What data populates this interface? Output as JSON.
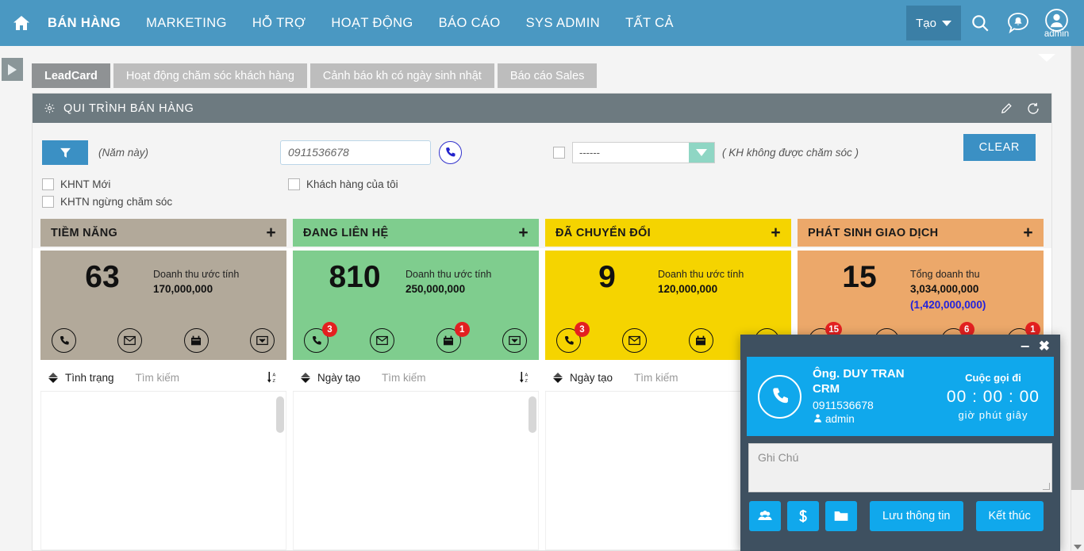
{
  "topnav": {
    "home_icon": "home-icon",
    "links": [
      "BÁN HÀNG",
      "MARKETING",
      "HỖ TRỢ",
      "HOẠT ĐỘNG",
      "BÁO CÁO",
      "SYS ADMIN",
      "TẤT CẢ"
    ],
    "create_button": "Tạo",
    "search_icon": "search-icon",
    "chat_icon": "chat-bell-icon",
    "avatar_label": "admin",
    "bg_color": "#4a98c2"
  },
  "tabs": [
    {
      "label": "LeadCard",
      "active": true
    },
    {
      "label": "Hoạt động chăm sóc khách hàng",
      "active": false
    },
    {
      "label": "Cảnh báo kh có ngày sinh nhật",
      "active": false
    },
    {
      "label": "Báo cáo Sales",
      "active": false
    }
  ],
  "panel": {
    "title": "QUI TRÌNH BÁN HÀNG",
    "gear_icon": "gear-icon",
    "edit_icon": "pencil-icon",
    "refresh_icon": "refresh-icon"
  },
  "filters": {
    "filter_icon": "funnel-icon",
    "year_label": "(Năm này)",
    "phone_value": "0911536678",
    "phone_placeholder": "0911536678",
    "call_icon": "phone-icon",
    "select_value": "------",
    "select_note": "( KH không được chăm sóc )",
    "clear_label": "CLEAR",
    "checkboxes": [
      {
        "label": "KHNT Mới",
        "checked": false
      },
      {
        "label": "KHTN ngừng chăm sóc",
        "checked": false
      },
      {
        "label": "Khách hàng của tôi",
        "checked": false
      }
    ]
  },
  "cards": [
    {
      "title": "TIỀM NĂNG",
      "head_color": "#b2a99a",
      "body_color": "#b2a99a",
      "count": "63",
      "revenue_label": "Doanh thu ước tính",
      "revenue_value": "170,000,000",
      "revenue_value2": "",
      "icons": [
        {
          "name": "phone-icon",
          "badge": ""
        },
        {
          "name": "email-icon",
          "badge": ""
        },
        {
          "name": "calendar-icon",
          "badge": ""
        },
        {
          "name": "inbox-icon",
          "badge": ""
        }
      ],
      "sort_field": "Tình trạng",
      "search_placeholder": "Tìm kiếm",
      "sort_icon": "sort-az-icon"
    },
    {
      "title": "ĐANG LIÊN HỆ",
      "head_color": "#7fcd8e",
      "body_color": "#7fcd8e",
      "count": "810",
      "revenue_label": "Doanh thu ước tính",
      "revenue_value": "250,000,000",
      "revenue_value2": "",
      "icons": [
        {
          "name": "phone-icon",
          "badge": "3"
        },
        {
          "name": "email-icon",
          "badge": ""
        },
        {
          "name": "calendar-icon",
          "badge": "1"
        },
        {
          "name": "inbox-icon",
          "badge": ""
        }
      ],
      "sort_field": "Ngày tạo",
      "search_placeholder": "Tìm kiếm",
      "sort_icon": "sort-az-icon"
    },
    {
      "title": "ĐÃ CHUYỂN ĐỔI",
      "head_color": "#f5d400",
      "body_color": "#f5d400",
      "count": "9",
      "revenue_label": "Doanh thu ước tính",
      "revenue_value": "120,000,000",
      "revenue_value2": "",
      "icons": [
        {
          "name": "phone-icon",
          "badge": "3"
        },
        {
          "name": "email-icon",
          "badge": ""
        },
        {
          "name": "calendar-icon",
          "badge": ""
        },
        {
          "name": "inbox-icon",
          "badge": ""
        }
      ],
      "sort_field": "Ngày tạo",
      "search_placeholder": "Tìm kiếm",
      "sort_icon": "sort-az-icon"
    },
    {
      "title": "PHÁT SINH GIAO DỊCH",
      "head_color": "#eda košenie",
      "body_color": "#eca86a",
      "count": "15",
      "revenue_label": "Tổng doanh thu",
      "revenue_value": "3,034,000,000",
      "revenue_value2": "(1,420,000,000)",
      "icons": [
        {
          "name": "phone-icon",
          "badge": "15"
        },
        {
          "name": "email-icon",
          "badge": ""
        },
        {
          "name": "calendar-icon",
          "badge": "6"
        },
        {
          "name": "inbox-icon",
          "badge": "1"
        }
      ],
      "sort_field": "",
      "search_placeholder": "",
      "sort_icon": "sort-az-icon"
    }
  ],
  "call_dialog": {
    "minimize_icon": "minimize-icon",
    "close_icon": "close-icon",
    "avatar_icon": "phone-icon",
    "contact_name": "Ông. DUY TRAN CRM",
    "contact_phone": "0911536678",
    "user_name": "admin",
    "user_icon": "user-icon",
    "direction": "Cuộc gọi đi",
    "timer": "00 : 00 : 00",
    "timer_units": "giờ  phút  giây",
    "note_placeholder": "Ghi Chú",
    "buttons": [
      {
        "name": "contacts-icon",
        "label": ""
      },
      {
        "name": "dollar-icon",
        "label": ""
      },
      {
        "name": "folder-icon",
        "label": ""
      }
    ],
    "save_label": "Lưu thông tin",
    "end_label": "Kết thúc",
    "accent_color": "#10a8ec",
    "frame_color": "#3e5060"
  }
}
